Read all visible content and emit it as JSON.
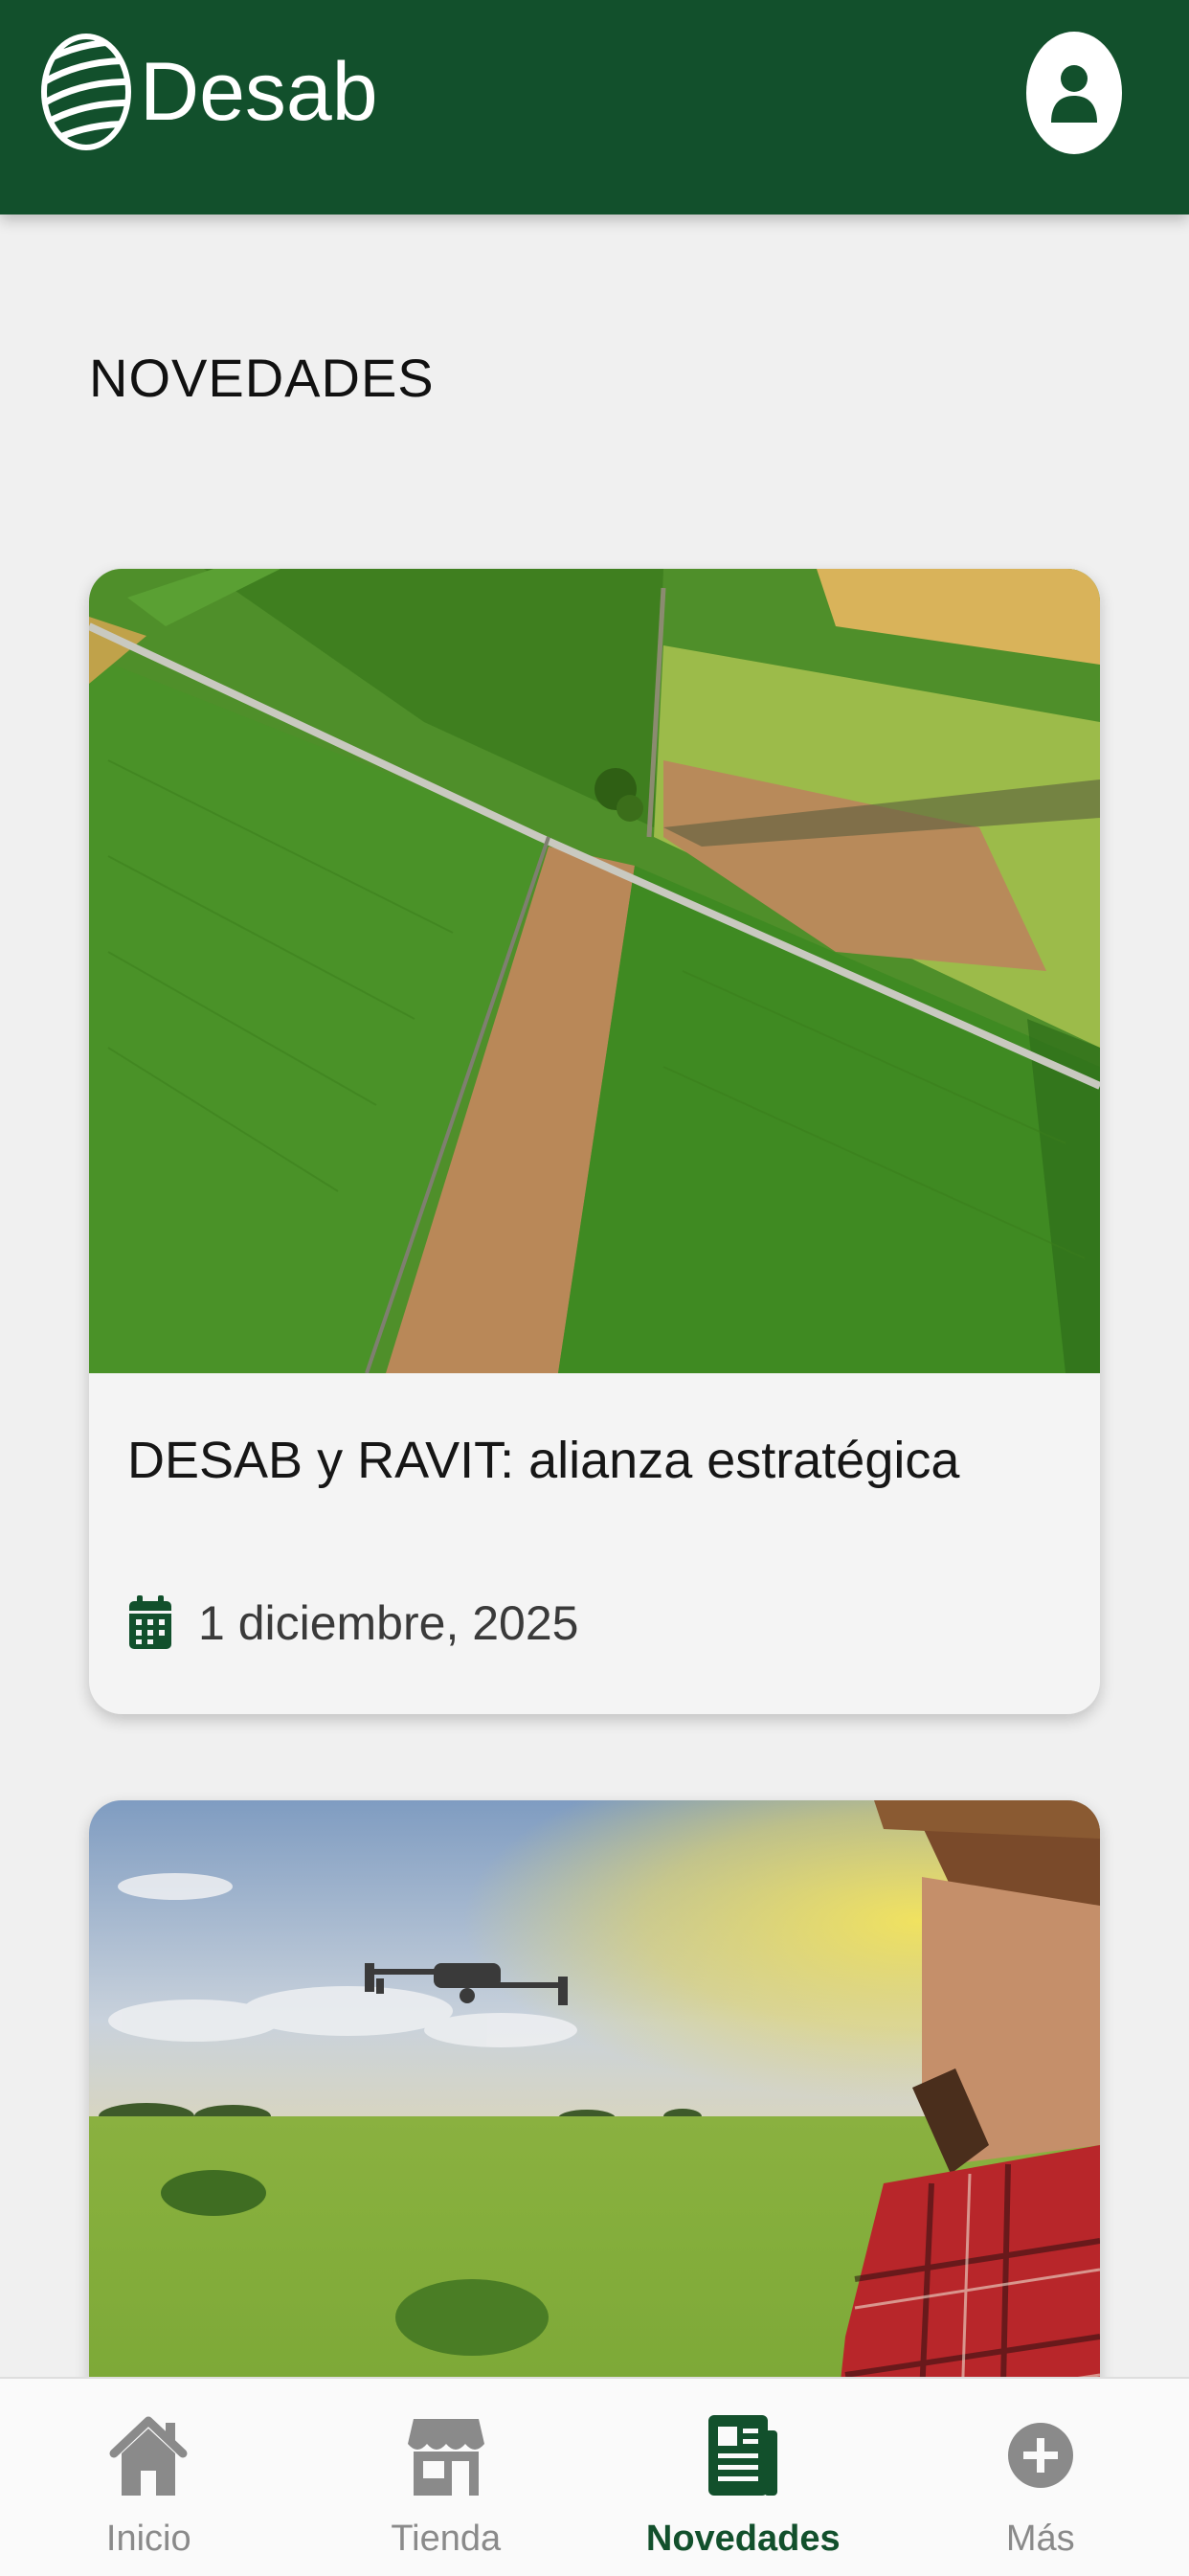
{
  "header": {
    "brand": "Desab",
    "logo_icon": "desab-leaf-logo",
    "profile_icon": "user-icon",
    "background_color": "#12502c"
  },
  "section": {
    "title": "NOVEDADES"
  },
  "news": [
    {
      "title": "DESAB y RAVIT: alianza estratégica",
      "date": "1 diciembre, 2025",
      "date_icon": "calendar-icon"
    },
    {
      "title": "",
      "date": ""
    }
  ],
  "bottom_nav": {
    "items": [
      {
        "label": "Inicio",
        "icon": "home-icon",
        "active": false
      },
      {
        "label": "Tienda",
        "icon": "store-icon",
        "active": false
      },
      {
        "label": "Novedades",
        "icon": "newspaper-icon",
        "active": true
      },
      {
        "label": "Más",
        "icon": "plus-circle-icon",
        "active": false
      }
    ],
    "active_color": "#12502c",
    "inactive_color": "#8a8a8a"
  }
}
